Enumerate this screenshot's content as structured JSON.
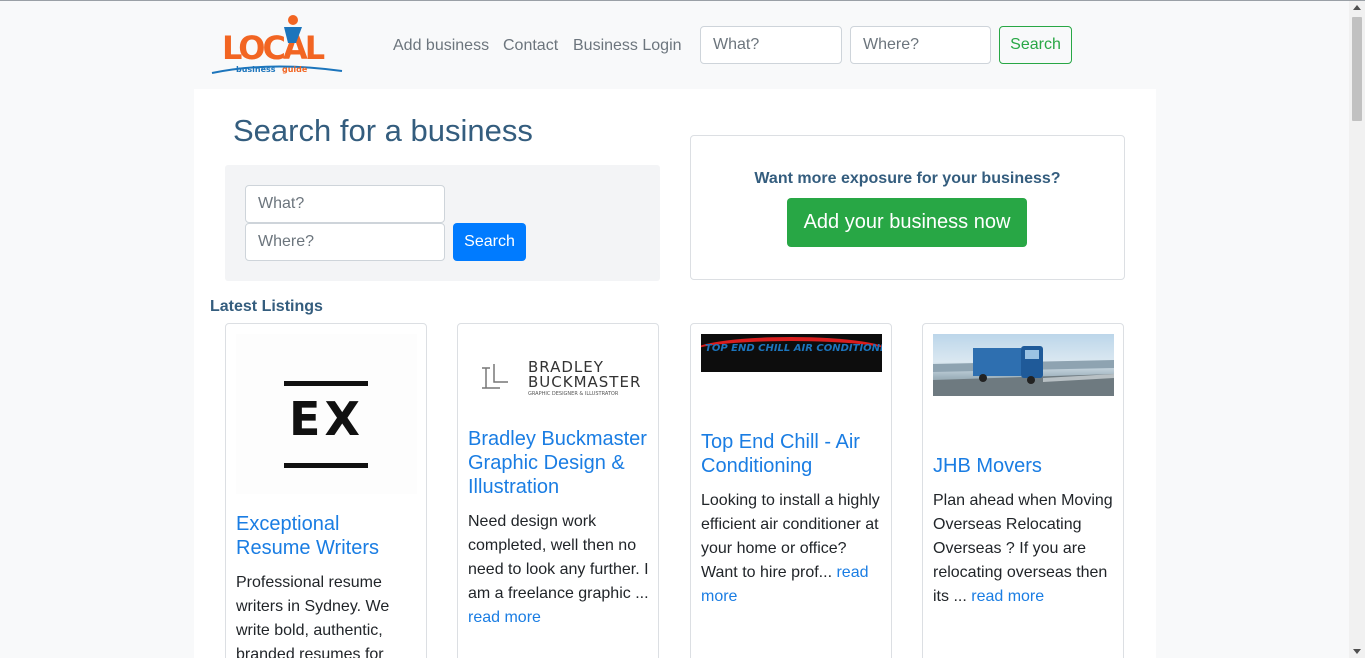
{
  "brand": {
    "logo_word": "LOCAL",
    "logo_tagline_a": "business",
    "logo_tagline_b": "guide"
  },
  "nav": {
    "links": [
      "Add business",
      "Contact",
      "Business Login"
    ],
    "what_placeholder": "What?",
    "where_placeholder": "Where?",
    "search_label": "Search"
  },
  "main": {
    "title": "Search for a business",
    "search": {
      "what_placeholder": "What?",
      "where_placeholder": "Where?",
      "button_label": "Search"
    },
    "promo": {
      "text": "Want more exposure for your business?",
      "button_label": "Add your business now"
    },
    "latest_heading": "Latest Listings",
    "read_more": "read more",
    "listings": [
      {
        "title": "Exceptional Resume Writers",
        "image_text": "EX",
        "text": "Professional resume writers in Sydney. We write bold, authentic, branded resumes for"
      },
      {
        "title": "Bradley Buckmaster Graphic Design & Illustration",
        "image_text_a": "BRADLEY",
        "image_text_b": "BUCKMASTER",
        "image_text_c": "GRAPHIC DESIGNER & ILLUSTRATOR",
        "text": "Need design work completed, well then no need to look any further. I am a freelance graphic ...",
        "link": "read more"
      },
      {
        "title": "Top End Chill - Air Conditioning",
        "image_text": "TOP END CHILL AIR CONDITIONING",
        "text": "Looking to install a highly efficient air conditioner at your home or office? Want to hire prof...",
        "link": "read more"
      },
      {
        "title": "JHB Movers",
        "text": "Plan ahead when Moving Overseas Relocating Overseas ? If you are relocating overseas then its ...",
        "link": "read more"
      }
    ]
  },
  "colors": {
    "primary": "#007bff",
    "success": "#28a745",
    "heading": "#345d7e",
    "link": "#1a7de3",
    "logo_orange": "#f26522",
    "logo_blue": "#1c75bc"
  }
}
